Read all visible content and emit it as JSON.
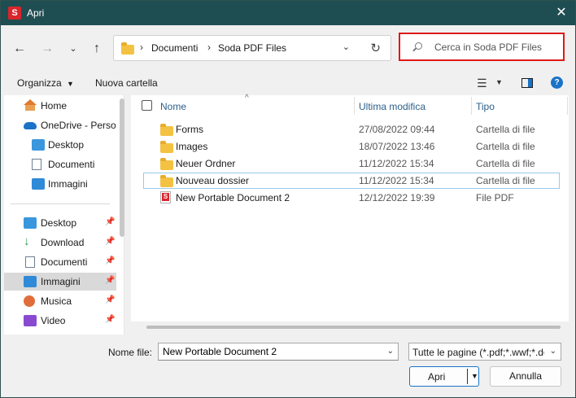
{
  "window": {
    "title": "Apri",
    "app_logo_letter": "S",
    "accent_color": "#1f4e52",
    "highlight_color": "#e0191a"
  },
  "address": {
    "crumbs": [
      "Documenti",
      "Soda PDF Files"
    ],
    "search_placeholder": "Cerca in Soda PDF Files"
  },
  "toolbar": {
    "organize_label": "Organizza",
    "new_folder_label": "Nuova cartella",
    "help_label": "?"
  },
  "nav": {
    "top": [
      {
        "label": "Home",
        "icon": "home-icon"
      },
      {
        "label": "OneDrive - Person",
        "icon": "cloud-icon"
      }
    ],
    "onedrive_children": [
      {
        "label": "Desktop",
        "icon": "desktop-icon"
      },
      {
        "label": "Documenti",
        "icon": "document-icon"
      },
      {
        "label": "Immagini",
        "icon": "pictures-icon"
      }
    ],
    "quick_access": [
      {
        "label": "Desktop",
        "icon": "desktop-icon"
      },
      {
        "label": "Download",
        "icon": "download-icon"
      },
      {
        "label": "Documenti",
        "icon": "document-icon"
      },
      {
        "label": "Immagini",
        "icon": "pictures-icon",
        "selected": true
      },
      {
        "label": "Musica",
        "icon": "music-icon"
      },
      {
        "label": "Video",
        "icon": "video-icon"
      }
    ]
  },
  "filelist": {
    "columns": {
      "name": "Nome",
      "modified": "Ultima modifica",
      "type": "Tipo"
    },
    "rows": [
      {
        "name": "Forms",
        "modified": "27/08/2022 09:44",
        "type": "Cartella di file",
        "icon": "folder-icon"
      },
      {
        "name": "Images",
        "modified": "18/07/2022 13:46",
        "type": "Cartella di file",
        "icon": "folder-icon"
      },
      {
        "name": "Neuer Ordner",
        "modified": "11/12/2022 15:34",
        "type": "Cartella di file",
        "icon": "folder-icon"
      },
      {
        "name": "Nouveau dossier",
        "modified": "11/12/2022 15:34",
        "type": "Cartella di file",
        "icon": "folder-icon",
        "focused": true
      },
      {
        "name": "New Portable Document 2",
        "modified": "12/12/2022 19:39",
        "type": "File PDF",
        "icon": "pdf-file-icon"
      }
    ]
  },
  "bottom": {
    "filename_label": "Nome file:",
    "filename_value": "New Portable Document 2",
    "filter_value": "Tutte le pagine (*.pdf;*.wwf;*.do",
    "open_label": "Apri",
    "cancel_label": "Annulla"
  }
}
